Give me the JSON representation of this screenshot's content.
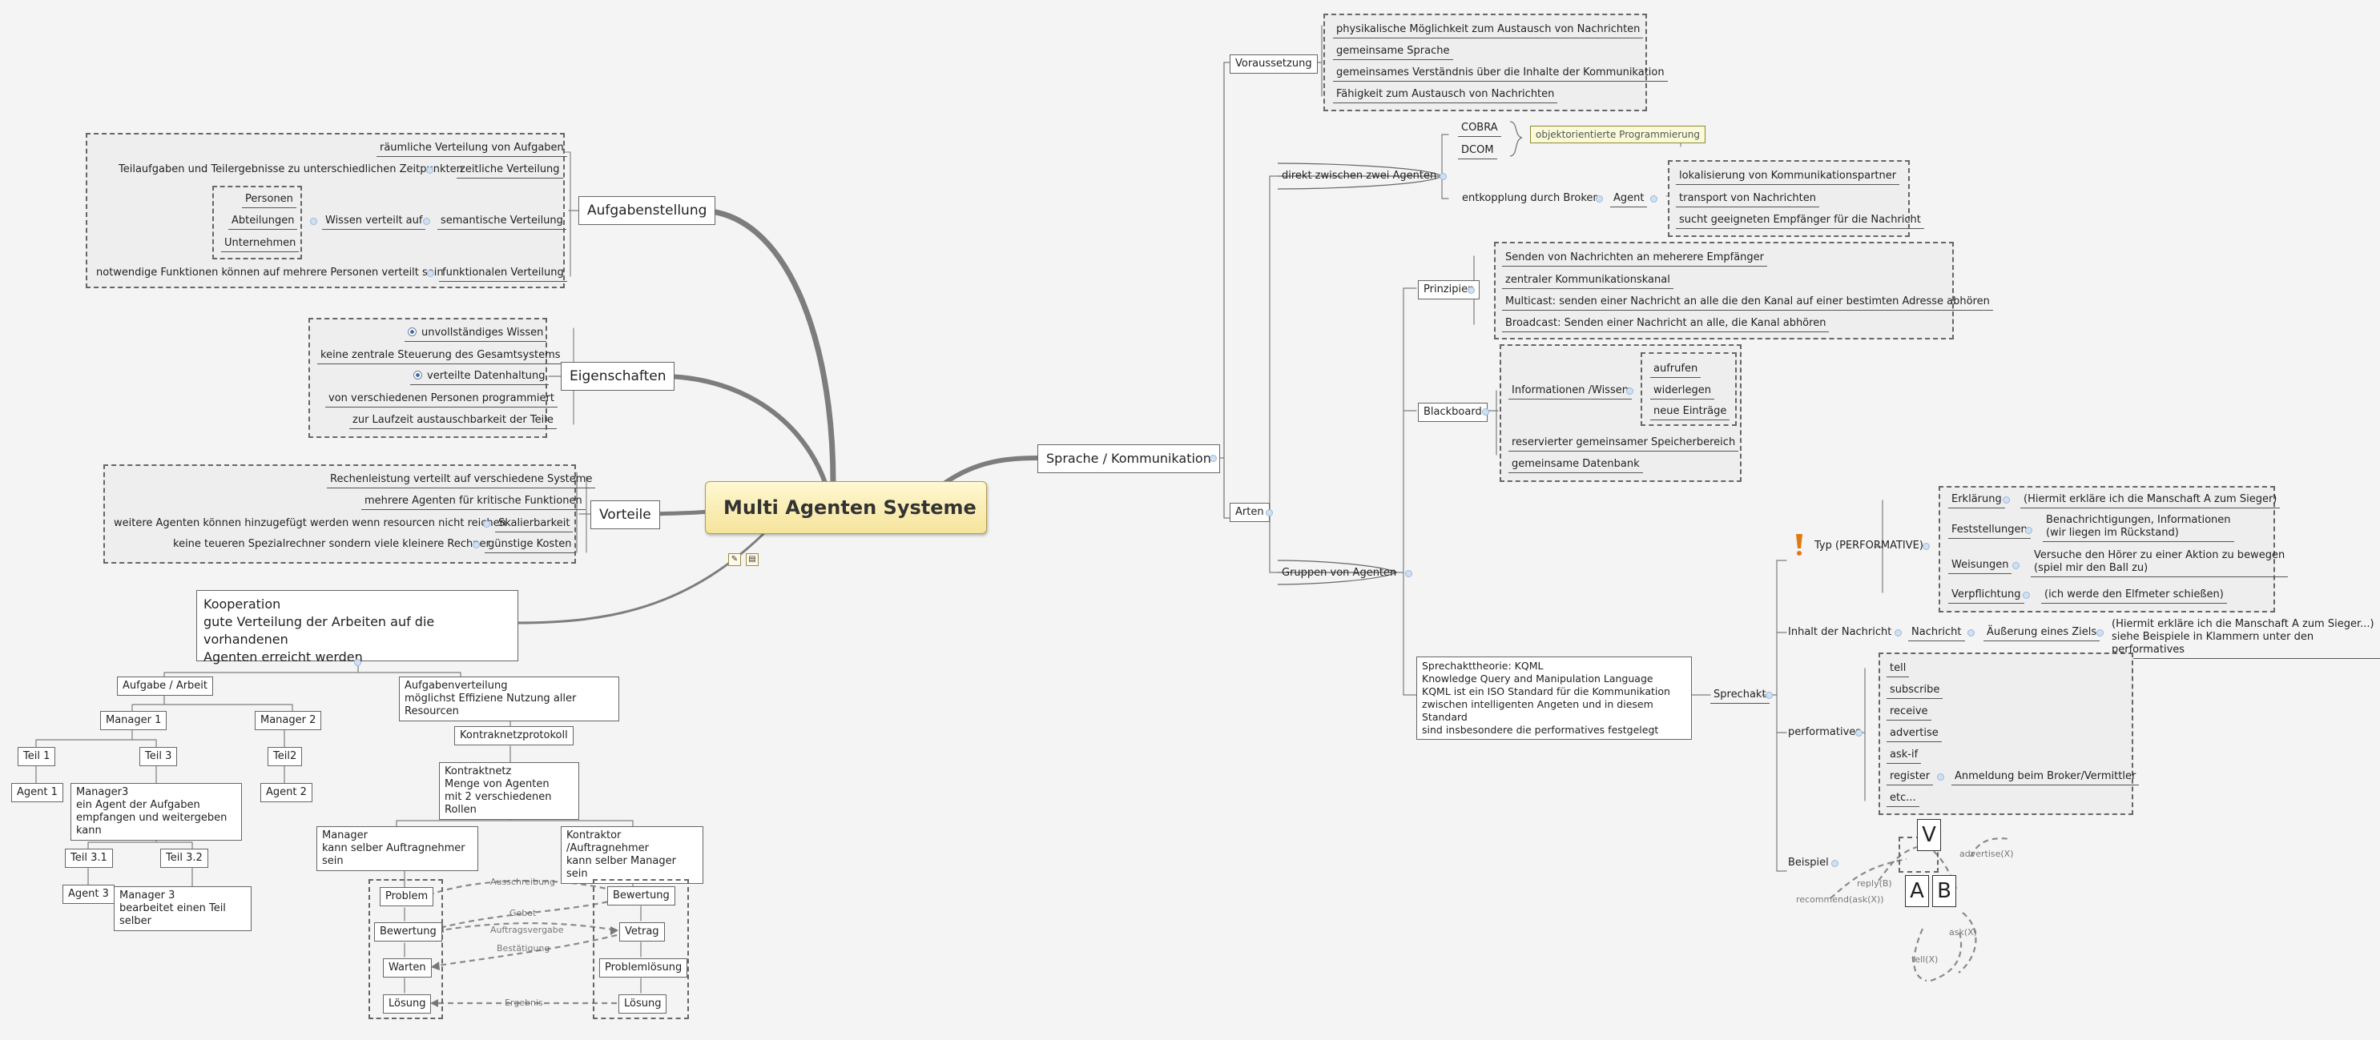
{
  "root": {
    "title": "Multi Agenten Systeme"
  },
  "aufgabenstellung": {
    "label": "Aufgabenstellung",
    "raeumlich": "räumliche Verteilung von Aufgaben",
    "teilaufgaben": "Teilaufgaben und Teilergebnisse zu unterschiedlichen Zeitpunkten",
    "zeitlich": "zeitliche Verteilung",
    "personen": "Personen",
    "abteilungen": "Abteilungen",
    "unternehmen": "Unternehmen",
    "wissen": "Wissen verteilt auf",
    "semantisch": "semantische Verteilung",
    "notwendige": "notwendige Funktionen können auf mehrere Personen verteilt sein",
    "funktional": "funktionalen Verteilung"
  },
  "eigenschaften": {
    "label": "Eigenschaften",
    "items": [
      "unvollständiges Wissen",
      "keine zentrale Steuerung des Gesamtsystems",
      "verteilte Datenhaltung",
      "von verschiedenen Personen programmiert",
      "zur Laufzeit austauschbarkeit der Teile"
    ]
  },
  "vorteile": {
    "label": "Vorteile",
    "rechenleistung": "Rechenleistung verteilt auf verschiedene Systeme",
    "mehrere": "mehrere Agenten für kritische Funktionen",
    "weitere": "weitere Agenten können hinzugefügt werden wenn resourcen nicht reichen",
    "skalierbarkeit": "Skalierbarkeit",
    "keine": "keine teueren Spezialrechner sondern viele kleinere Rechner",
    "guenstige": "günstige Kosten"
  },
  "kooperation": {
    "title": "Kooperation\ngute Verteilung der Arbeiten auf die vorhandenen\nAgenten erreicht werden",
    "aufgabe": "Aufgabe / Arbeit",
    "manager1": "Manager 1",
    "manager2": "Manager 2",
    "teil1": "Teil 1",
    "teil3": "Teil 3",
    "teil2": "Teil2",
    "agent1": "Agent 1",
    "agent2": "Agent 2",
    "manager3a": "Manager3\nein Agent der Aufgaben\nempfangen und weitergeben kann",
    "teil31": "Teil 3.1",
    "teil32": "Teil 3.2",
    "agent3": "Agent 3",
    "manager3b": "Manager 3\nbearbeitet einen Teil selber",
    "aufgabenverteilung": "Aufgabenverteilung\nmöglichst Effiziene Nutzung aller Resourcen",
    "kontraktnetzprotokoll": "Kontraknetzprotokoll",
    "kontraktnetz": "Kontraktnetz\nMenge von Agenten\nmit 2 verschiedenen Rollen",
    "manager": "Manager\nkann selber Auftragnehmer sein",
    "kontraktor": "Kontraktor /Auftragnehmer\nkann selber Manager sein",
    "problem": "Problem",
    "bewertung_l": "Bewertung",
    "warten": "Warten",
    "loesung_l": "Lösung",
    "bewertung_r": "Bewertung",
    "vetrag": "Vetrag",
    "problemloesung": "Problemlösung",
    "loesung_r": "Lösung",
    "ausschreibung": "Ausschreibung",
    "gebot": "Gebot",
    "auftragsvergabe": "Auftragsvergabe",
    "bestaetigung": "Bestätigung",
    "ergebnis": "Ergebnis"
  },
  "sprache": {
    "label": "Sprache / Kommunikation",
    "voraussetzung": "Voraussetzung",
    "voraus_items": [
      "physikalische Möglichkeit zum Austausch von Nachrichten",
      "gemeinsame Sprache",
      "gemeinsames Verständnis über die Inhalte der Kommunikation",
      "Fähigkeit zum Austausch von Nachrichten"
    ],
    "arten": "Arten",
    "direkt": "direkt zwischen zwei Agenten",
    "cobra": "COBRA",
    "dcom": "DCOM",
    "objekt": "objektorientierte Programmierung",
    "entkopplung": "entkopplung durch Broker",
    "agent": "Agent",
    "agent_items": [
      "lokalisierung von Kommunikationspartner",
      "transport von Nachrichten",
      "sucht geeigneten Empfänger für die Nachricht"
    ],
    "gruppen": "Gruppen von Agenten",
    "prinzipien": "Prinzipien",
    "prinzipien_items": [
      "Senden von Nachrichten an meherere Empfänger",
      "zentraler Kommunikationskanal",
      "Multicast: senden einer Nachricht an alle die den Kanal auf einer bestimten Adresse abhören",
      "Broadcast: Senden einer Nachricht an alle, die Kanal abhören"
    ],
    "blackboard": "Blackboard",
    "informationen": "Informationen /Wissen",
    "info_items": [
      "aufrufen",
      "widerlegen",
      "neue Einträge"
    ],
    "reservierter": "reservierter gemeinsamer Speicherbereich",
    "gemeinsame_db": "gemeinsame Datenbank",
    "sprechakttheorie": "Sprechakttheorie: KQML\nKnowledge Query and Manipulation Language\nKQML ist ein ISO Standard für die Kommunikation\nzwischen intelligenten Angeten und in diesem Standard\nsind insbesondere die performatives festgelegt",
    "sprechakt": "Sprechakt",
    "typ": "Typ (PERFORMATIVE)",
    "erklaerung": "Erklärung",
    "erklaerung_ex": "(Hiermit erkläre ich die Manschaft A zum Sieger)",
    "feststellungen": "Feststellungen",
    "feststellungen_ex": "Benachrichtigungen, Informationen\n(wir liegen im Rückstand)",
    "weisungen": "Weisungen",
    "weisungen_ex": "Versuche den Hörer zu einer Aktion zu bewegen\n(spiel mir den Ball zu)",
    "verpflichtung": "Verpflichtung",
    "verpflichtung_ex": "(ich werde den Elfmeter schießen)",
    "inhalt": "Inhalt der Nachricht",
    "nachricht": "Nachricht",
    "aeusserung": "Äußerung eines Ziels",
    "aeusserung_ex": "(Hiermit erkläre ich die Manschaft A zum Sieger...)\nsiehe Beispiele in Klammern unter den performatives",
    "performatives": "performatives",
    "perf_items": [
      "tell",
      "subscribe",
      "receive",
      "advertise",
      "ask-if",
      "register",
      "etc..."
    ],
    "anmeldung": "Anmeldung beim Broker/Vermittler",
    "beispiel": "Beispiel",
    "v": "V",
    "a": "A",
    "b": "B",
    "advertise_x": "advertise(X)",
    "reply_b": "reply(B)",
    "recommend": "recommend(ask(X))",
    "ask_x": "ask(X)",
    "tell_x": "tell(X)"
  },
  "colors": {
    "root_fill": "#f5e49c",
    "branch": "#808080",
    "dot": "#cfe0f2"
  }
}
